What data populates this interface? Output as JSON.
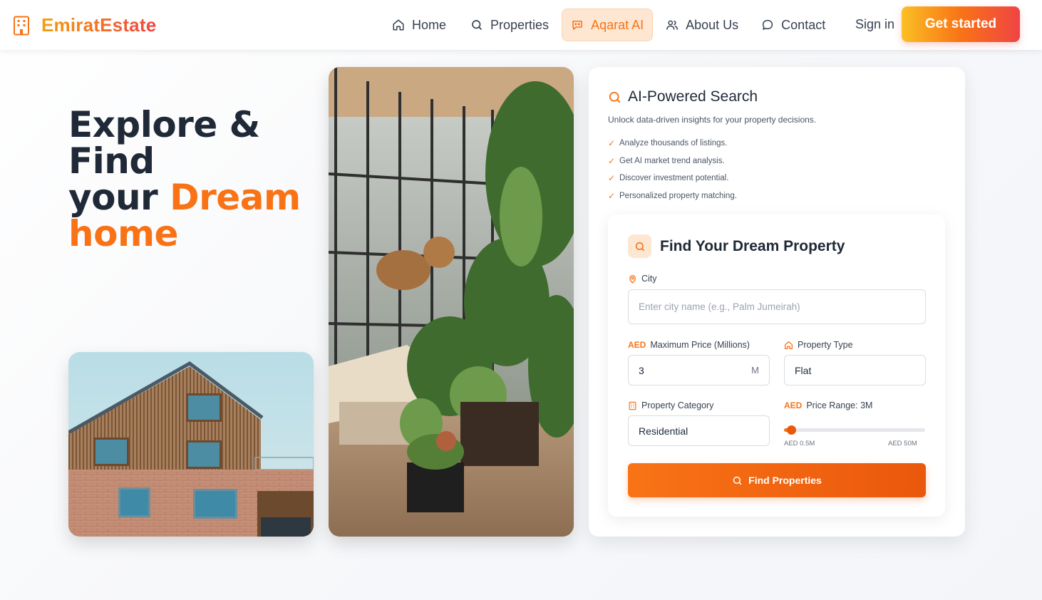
{
  "header": {
    "brand": "EmiratEstate",
    "nav": [
      {
        "label": "Home",
        "icon": "home-icon"
      },
      {
        "label": "Properties",
        "icon": "search-icon"
      },
      {
        "label": "Aqarat AI",
        "icon": "chat-bot-icon",
        "active": true
      },
      {
        "label": "About Us",
        "icon": "users-icon"
      },
      {
        "label": "Contact",
        "icon": "message-icon"
      }
    ],
    "signin": "Sign in",
    "cta": "Get started"
  },
  "hero": {
    "line1": "Explore &",
    "line2": "Find",
    "line3_a": "your",
    "line3_b": "Dream",
    "line4": "home"
  },
  "search_card": {
    "title": "AI-Powered Search",
    "subtitle": "Unlock data-driven insights for your property decisions.",
    "features": [
      "Analyze thousands of listings.",
      "Get AI market trend analysis.",
      "Discover investment potential.",
      "Personalized property matching."
    ],
    "form": {
      "title": "Find Your Dream Property",
      "city_label": "City",
      "city_placeholder": "Enter city name (e.g., Palm Jumeirah)",
      "aed": "AED",
      "max_price_label": "Maximum Price (Millions)",
      "max_price_value": "3",
      "max_price_suffix": "M",
      "type_label": "Property Type",
      "type_value": "Flat",
      "category_label": "Property Category",
      "category_value": "Residential",
      "range_label": "Price Range: 3M",
      "range_min_label": "AED 0.5M",
      "range_max_label": "AED 50M",
      "range_min": 0.5,
      "range_max": 50,
      "range_value": 3,
      "submit": "Find Properties"
    }
  },
  "colors": {
    "accent": "#f97316",
    "accent_dark": "#ea580c",
    "text": "#1f2937"
  }
}
